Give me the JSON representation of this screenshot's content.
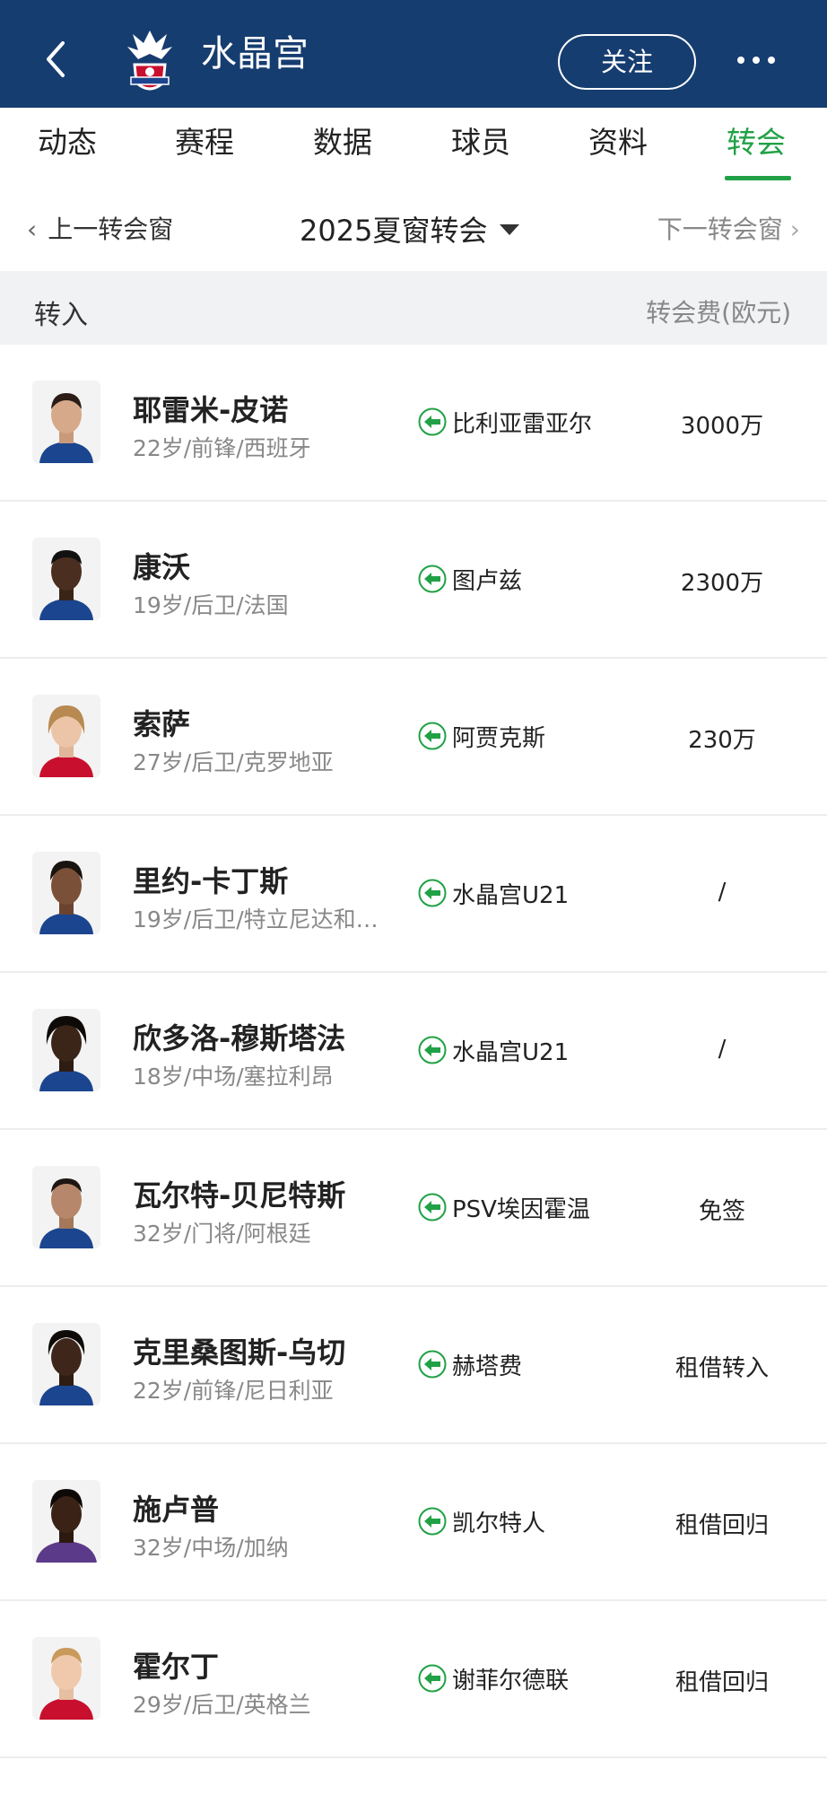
{
  "header": {
    "title": "水晶宫",
    "follow_label": "关注"
  },
  "tabs": [
    {
      "label": "动态"
    },
    {
      "label": "赛程"
    },
    {
      "label": "数据"
    },
    {
      "label": "球员"
    },
    {
      "label": "资料"
    },
    {
      "label": "转会"
    }
  ],
  "window": {
    "prev_label": "上一转会窗",
    "current_label": "2025夏窗转会",
    "next_label": "下一转会窗"
  },
  "section": {
    "title": "转入",
    "fee_header": "转会费(欧元)"
  },
  "transfers": [
    {
      "name": "耶雷米-皮诺",
      "meta": "22岁/前锋/西班牙",
      "from_club": "比利亚雷亚尔",
      "fee": "3000万"
    },
    {
      "name": "康沃",
      "meta": "19岁/后卫/法国",
      "from_club": "图卢兹",
      "fee": "2300万"
    },
    {
      "name": "索萨",
      "meta": "27岁/后卫/克罗地亚",
      "from_club": "阿贾克斯",
      "fee": "230万"
    },
    {
      "name": "里约-卡丁斯",
      "meta": "19岁/后卫/特立尼达和…",
      "from_club": "水晶宫U21",
      "fee": "/"
    },
    {
      "name": "欣多洛-穆斯塔法",
      "meta": "18岁/中场/塞拉利昂",
      "from_club": "水晶宫U21",
      "fee": "/"
    },
    {
      "name": "瓦尔特-贝尼特斯",
      "meta": "32岁/门将/阿根廷",
      "from_club": "PSV埃因霍温",
      "fee": "免签"
    },
    {
      "name": "克里桑图斯-乌切",
      "meta": "22岁/前锋/尼日利亚",
      "from_club": "赫塔费",
      "fee": "租借转入"
    },
    {
      "name": "施卢普",
      "meta": "32岁/中场/加纳",
      "from_club": "凯尔特人",
      "fee": "租借回归"
    },
    {
      "name": "霍尔丁",
      "meta": "29岁/后卫/英格兰",
      "from_club": "谢菲尔德联",
      "fee": "租借回归"
    }
  ],
  "colors": {
    "header_bg": "#163d70",
    "accent": "#21a146",
    "transfer_in_icon": "#21a146"
  }
}
